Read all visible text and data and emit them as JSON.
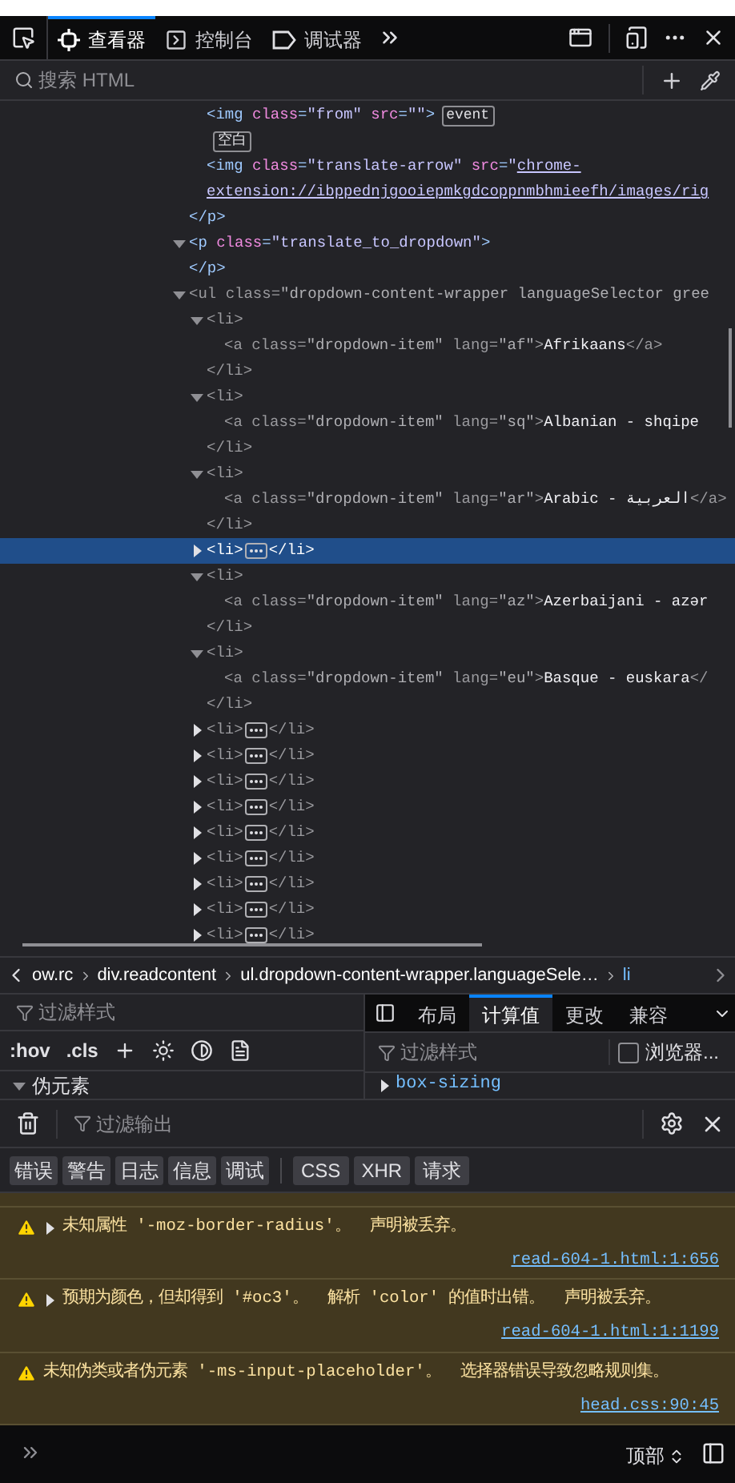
{
  "toolbar": {
    "tabs": [
      {
        "label": "查看器",
        "selected": true
      },
      {
        "label": "控制台",
        "selected": false
      },
      {
        "label": "调试器",
        "selected": false
      }
    ]
  },
  "search": {
    "placeholder": "搜索 HTML"
  },
  "markup": {
    "nodes": [
      {
        "kind": "tail",
        "close": "</p>",
        "children": [
          {
            "kind": "element",
            "open": "<img class=\"from\" src=\"\">",
            "selected": false,
            "dimmed": false,
            "badges": [
              "event"
            ]
          },
          {
            "kind": "whitespace",
            "label": "空白",
            "selected": false
          },
          {
            "kind": "element",
            "open": "<img class=\"translate-arrow\" src=\"",
            "link": "chrome-extension://ibppednjgooiepmkgdcoppnmbhmieefh/images/rig",
            "selected": false,
            "dimmed": false
          }
        ]
      },
      {
        "kind": "element",
        "open": "<p class=\"translate_to_dropdown\">",
        "close": "</p>",
        "expanded": true,
        "selected": false,
        "dimmed": false
      },
      {
        "kind": "element",
        "open": "<ul class=\"dropdown-content-wrapper languageSelector gree",
        "expanded": true,
        "selected": false,
        "dimmed": true,
        "children": [
          {
            "kind": "element",
            "open": "<li>",
            "close": "</li>",
            "expanded": true,
            "selected": false,
            "dimmed": true,
            "children": [
              {
                "kind": "element",
                "open": "<a class=\"dropdown-item\" lang=\"af\">Afrikaans</a>",
                "selected": false,
                "dimmed": true
              }
            ]
          },
          {
            "kind": "element",
            "open": "<li>",
            "close": "</li>",
            "expanded": true,
            "selected": false,
            "dimmed": true,
            "children": [
              {
                "kind": "element",
                "open": "<a class=\"dropdown-item\" lang=\"sq\">Albanian - shqipe",
                "selected": false,
                "dimmed": true
              }
            ]
          },
          {
            "kind": "element",
            "open": "<li>",
            "close": "</li>",
            "expanded": true,
            "selected": false,
            "dimmed": true,
            "children": [
              {
                "kind": "element",
                "open": "<a class=\"dropdown-item\" lang=\"ar\">Arabic - العربية</a>",
                "selected": false,
                "dimmed": true
              }
            ]
          },
          {
            "kind": "element",
            "open": "<li>",
            "close": "</li>",
            "expanded": false,
            "selected": true,
            "dimmed": true
          },
          {
            "kind": "element",
            "open": "<li>",
            "close": "</li>",
            "expanded": true,
            "selected": false,
            "dimmed": true,
            "children": [
              {
                "kind": "element",
                "open": "<a class=\"dropdown-item\" lang=\"az\">Azerbaijani - azər",
                "selected": false,
                "dimmed": true
              }
            ]
          },
          {
            "kind": "element",
            "open": "<li>",
            "close": "</li>",
            "expanded": true,
            "selected": false,
            "dimmed": true,
            "children": [
              {
                "kind": "element",
                "open": "<a class=\"dropdown-item\" lang=\"eu\">Basque - euskara</",
                "selected": false,
                "dimmed": true
              }
            ]
          },
          {
            "kind": "element",
            "open": "<li>",
            "close": "</li>",
            "expanded": false,
            "selected": false,
            "dimmed": true
          },
          {
            "kind": "element",
            "open": "<li>",
            "close": "</li>",
            "expanded": false,
            "selected": false,
            "dimmed": true
          },
          {
            "kind": "element",
            "open": "<li>",
            "close": "</li>",
            "expanded": false,
            "selected": false,
            "dimmed": true
          },
          {
            "kind": "element",
            "open": "<li>",
            "close": "</li>",
            "expanded": false,
            "selected": false,
            "dimmed": true
          },
          {
            "kind": "element",
            "open": "<li>",
            "close": "</li>",
            "expanded": false,
            "selected": false,
            "dimmed": true
          },
          {
            "kind": "element",
            "open": "<li>",
            "close": "</li>",
            "expanded": false,
            "selected": false,
            "dimmed": true
          },
          {
            "kind": "element",
            "open": "<li>",
            "close": "</li>",
            "expanded": false,
            "selected": false,
            "dimmed": true
          },
          {
            "kind": "element",
            "open": "<li>",
            "close": "</li>",
            "expanded": false,
            "selected": false,
            "dimmed": true
          },
          {
            "kind": "element",
            "open": "<li>",
            "close": "</li>",
            "expanded": false,
            "selected": false,
            "dimmed": true
          }
        ]
      }
    ]
  },
  "breadcrumbs": [
    {
      "label": "ow.rc",
      "selected": false
    },
    {
      "label": "div.readcontent",
      "selected": false
    },
    {
      "label": "ul.dropdown-content-wrapper.languageSele…",
      "selected": false
    },
    {
      "label": "li",
      "selected": true
    }
  ],
  "rules": {
    "filter_placeholder": "过滤样式",
    "toggles": [
      ":hov",
      ".cls"
    ],
    "sections": [
      {
        "label": "伪元素",
        "expanded": true
      }
    ]
  },
  "sidebar": {
    "tabs": [
      {
        "label": "布局",
        "selected": false
      },
      {
        "label": "计算值",
        "selected": true
      },
      {
        "label": "更改",
        "selected": false
      },
      {
        "label": "兼容",
        "selected": false
      }
    ],
    "filter_placeholder": "过滤样式",
    "browser_styles": {
      "label": "浏览器...",
      "checked": false
    },
    "properties": [
      {
        "name": "box-sizing",
        "expanded": false
      }
    ]
  },
  "console": {
    "filter_placeholder": "过滤输出",
    "filters": [
      "错误",
      "警告",
      "日志",
      "信息",
      "调试"
    ],
    "request_filters": [
      "CSS",
      "XHR",
      "请求"
    ],
    "messages": [
      {
        "kind": "warning",
        "expandable": true,
        "text": "未知属性 '-moz-border-radius'。  声明被丢弃。",
        "source": "read-604-1.html:1:656"
      },
      {
        "kind": "warning",
        "expandable": true,
        "text": "预期为颜色，但却得到 '#oc3'。  解析 'color' 的值时出错。  声明被丢弃。",
        "source": "read-604-1.html:1:1199"
      },
      {
        "kind": "warning",
        "expandable": false,
        "text": "未知伪类或者伪元素 '-ms-input-placeholder'。  选择器错误导致忽略规则集。",
        "source": "head.css:90:45"
      }
    ],
    "context": "顶部"
  }
}
